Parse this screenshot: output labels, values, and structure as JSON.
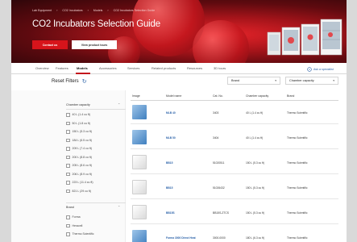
{
  "hero": {
    "breadcrumb": [
      "Lab Equipment",
      "CO2 Incubators",
      "Models",
      "CO2 Incubators Selection Guide"
    ],
    "title": "CO2 Incubators Selection Guide",
    "contact_label": "Contact us",
    "view_label": "View product tours"
  },
  "tabs": [
    "Overview",
    "Features",
    "Models",
    "Accessories",
    "Services",
    "Related products",
    "Resources",
    "3D tours"
  ],
  "active_tab": "Models",
  "specialist_label": "Ask a specialist",
  "filter": {
    "reset_label": "Reset Filters",
    "brand_select": "Brand",
    "capacity_select": "Chamber capacity"
  },
  "facets": {
    "capacity_title": "Chamber capacity",
    "capacity_options": [
      "40 L (1.4 cu ft)",
      "50 L (1.8 cu ft)",
      "150 L (5.3 cu ft)",
      "184 L (6.5 cu ft)",
      "209 L (7.4 cu ft)",
      "200 L (8.8 cu ft)",
      "205 L (8.6 cu ft)",
      "206 L (8.9 cu ft)",
      "223 L (11.4 cu ft)",
      "821 L (29 cu ft)"
    ],
    "brand_title": "Brand",
    "brand_options": [
      "Forma",
      "Heracell",
      "Thermo Scientific"
    ]
  },
  "table": {
    "headers": [
      "Image",
      "Model name",
      "Cat. No.",
      "Chamber capacity",
      "Brand"
    ],
    "rows": [
      {
        "model": "MLB 40",
        "cat": "3403",
        "capacity": "40 L (1.4 cu ft)",
        "brand": "Thermo Scientific",
        "image": "blue"
      },
      {
        "model": "MLB 50",
        "cat": "3404",
        "capacity": "40 L (1.4 cu ft)",
        "brand": "Thermo Scientific",
        "image": "blue"
      },
      {
        "model": "BB15",
        "cat": "51020511",
        "capacity": "150 L (5.3 cu ft)",
        "brand": "Thermo Scientific",
        "image": "white"
      },
      {
        "model": "BB15",
        "cat": "51026432",
        "capacity": "150 L (5.3 cu ft)",
        "brand": "Thermo Scientific",
        "image": "white"
      },
      {
        "model": "BB15S",
        "cat": "BB15S-ZTCS",
        "capacity": "150 L (5.3 cu ft)",
        "brand": "Thermo Scientific",
        "image": "white"
      },
      {
        "model": "Forma 3000 Direct Heat",
        "cat": "3000-0000",
        "capacity": "180 L (6.3 cu ft)",
        "brand": "Thermo Scientific",
        "image": "blue"
      }
    ]
  },
  "colors": {
    "accent": "#c3161d",
    "link": "#2a61a8"
  }
}
